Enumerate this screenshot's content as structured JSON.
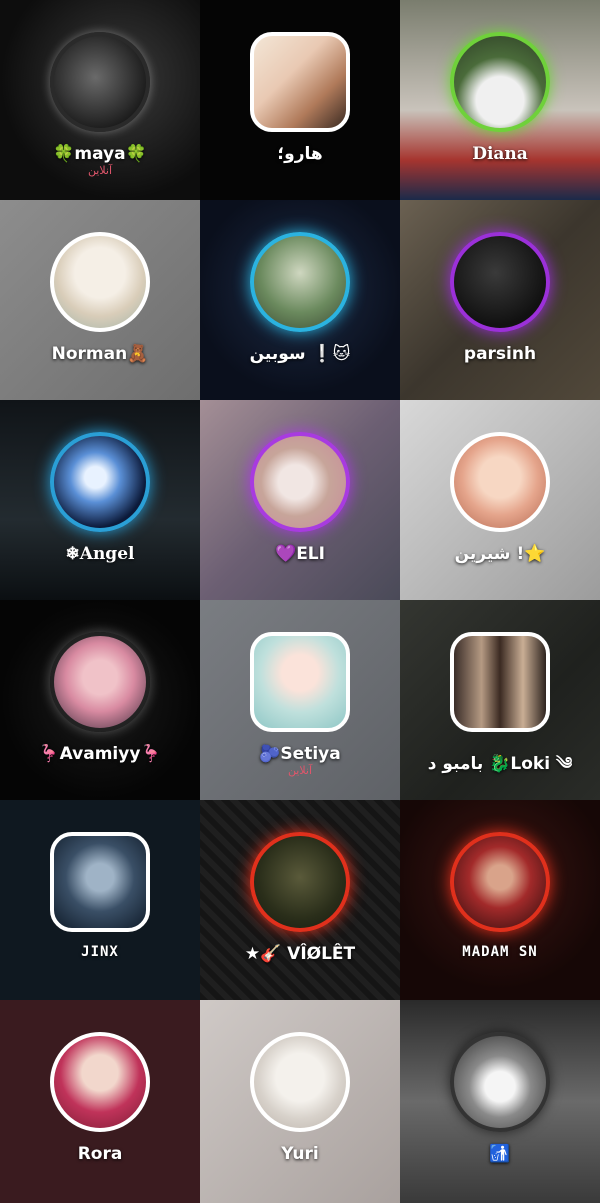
{
  "users": [
    {
      "name": "🍀maya🍀",
      "status": "آنلاین",
      "frame": "circle",
      "ring": "#2a2a2a"
    },
    {
      "name": "هارو؛",
      "frame": "square",
      "ring": "#ffffff"
    },
    {
      "name": "Diana",
      "frame": "circle",
      "ring": "#6fd13a"
    },
    {
      "name": "Norman🧸",
      "frame": "circle",
      "ring": "#ffffff"
    },
    {
      "name": "سوبین ❕🐱",
      "frame": "circle",
      "ring": "#2bb3e0"
    },
    {
      "name": "parsinh",
      "frame": "circle",
      "ring": "#9b30d9"
    },
    {
      "name": "❄Angel",
      "frame": "circle",
      "ring": "#2a9fd6"
    },
    {
      "name": "💜ELI",
      "frame": "circle",
      "ring": "#a83be0"
    },
    {
      "name": "شیرین !⭐",
      "frame": "circle",
      "ring": "#ffffff"
    },
    {
      "name": "🦩Avamiyy🦩",
      "frame": "circle",
      "ring": "#222222"
    },
    {
      "name": "🫐Setiya",
      "status": "آنلاین",
      "frame": "square",
      "ring": "#ffffff"
    },
    {
      "name": "بامبو د 🐉Loki ༄",
      "frame": "square",
      "ring": "#ffffff"
    },
    {
      "name": "JINX",
      "frame": "square",
      "ring": "#ffffff"
    },
    {
      "name": "★🎸 VÎØLÊT",
      "frame": "circle",
      "ring": "#e0301c"
    },
    {
      "name": "MADAM SN",
      "frame": "circle",
      "ring": "#e0301c"
    },
    {
      "name": "Rora",
      "frame": "circle",
      "ring": "#ffffff"
    },
    {
      "name": "Yuri",
      "frame": "circle",
      "ring": "#ffffff"
    },
    {
      "name": "🚮",
      "frame": "circle",
      "ring": "#333333"
    }
  ]
}
